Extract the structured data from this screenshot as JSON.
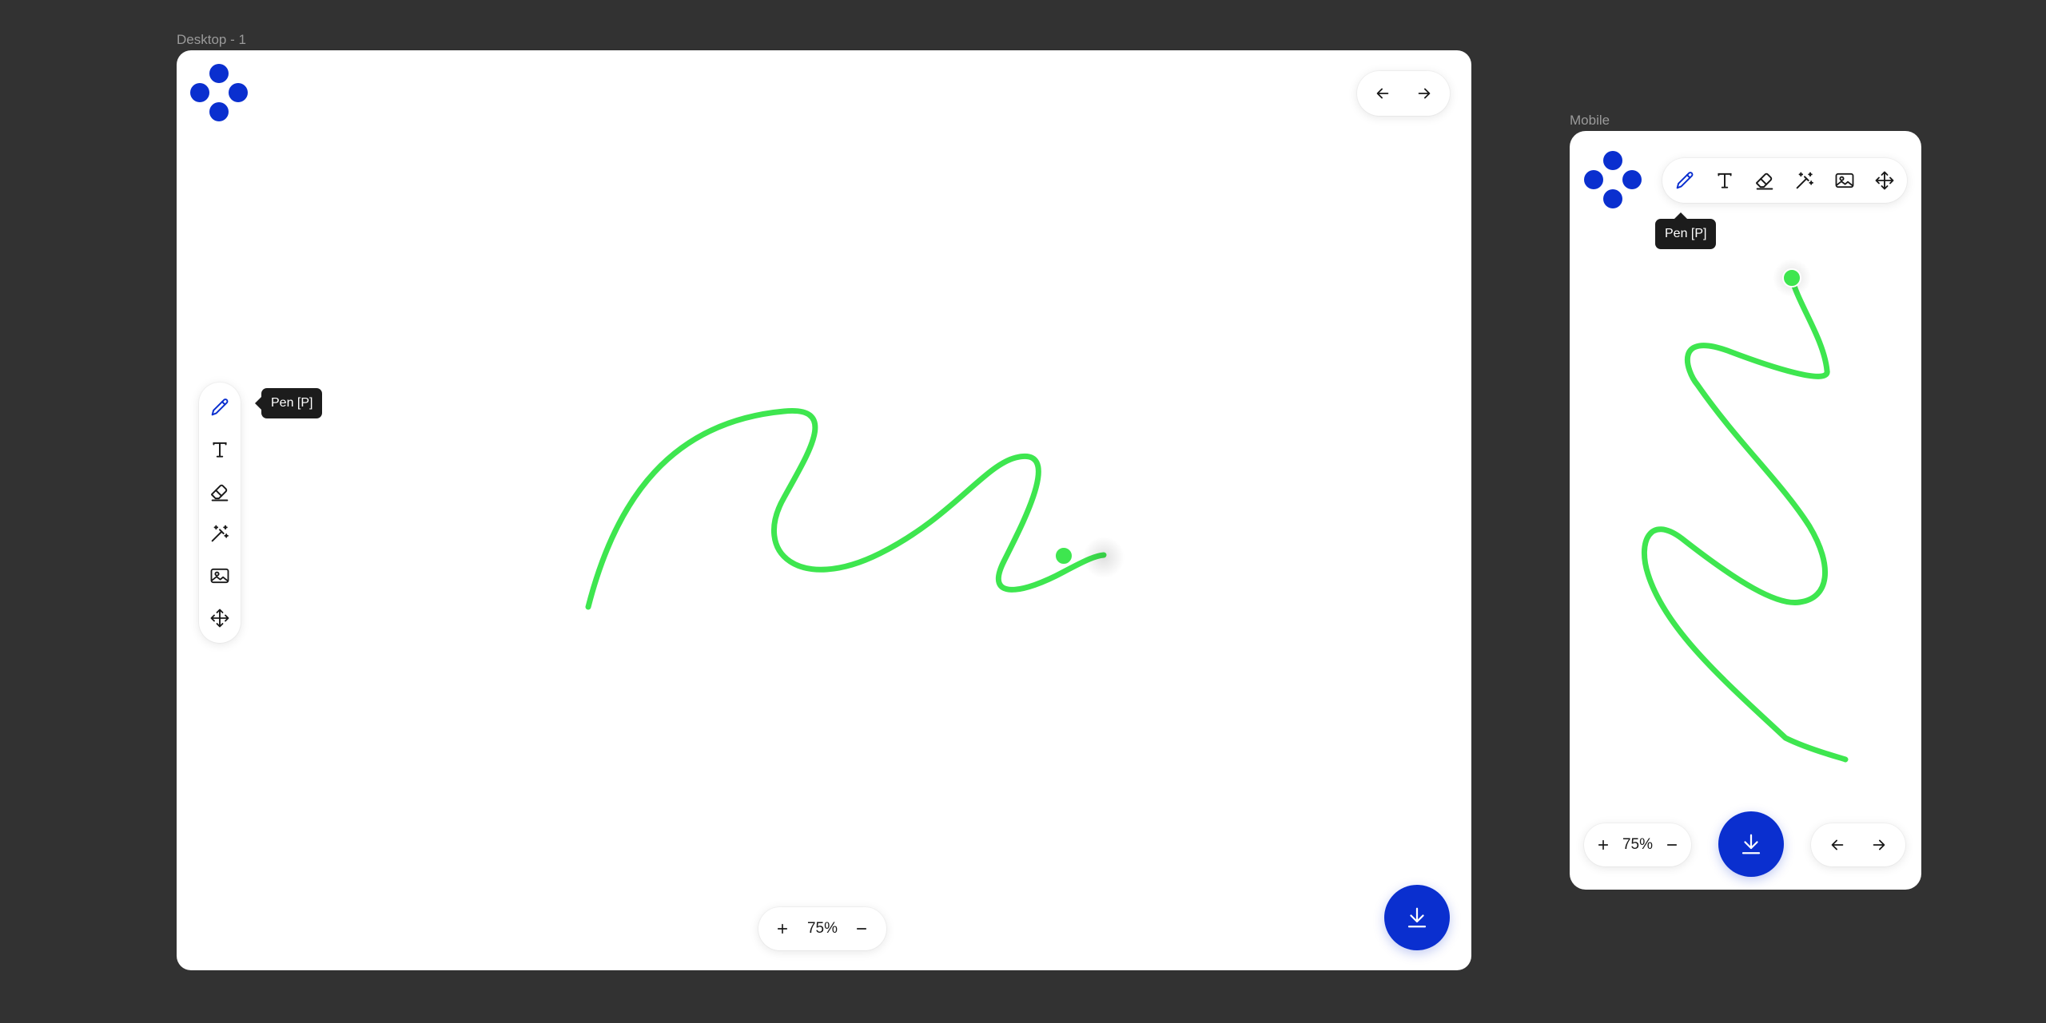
{
  "colors": {
    "background": "#323232",
    "accent": "#0a2fcf",
    "stroke": "#3ee64f",
    "artboard": "#ffffff"
  },
  "desktop": {
    "label": "Desktop - 1",
    "logo_icon": "logo-icon",
    "nav": {
      "back_icon": "arrow-left-icon",
      "forward_icon": "arrow-right-icon"
    },
    "tools": [
      {
        "name": "pen",
        "icon": "pen-icon",
        "active": true
      },
      {
        "name": "text",
        "icon": "text-icon",
        "active": false
      },
      {
        "name": "eraser",
        "icon": "eraser-icon",
        "active": false
      },
      {
        "name": "magic",
        "icon": "magic-wand-icon",
        "active": false
      },
      {
        "name": "image",
        "icon": "image-icon",
        "active": false
      },
      {
        "name": "move",
        "icon": "move-icon",
        "active": false
      }
    ],
    "tooltip": "Pen [P]",
    "zoom": {
      "in_icon": "plus-icon",
      "value": "75%",
      "out_icon": "minus-icon"
    },
    "download_icon": "download-icon"
  },
  "mobile": {
    "label": "Mobile",
    "logo_icon": "logo-icon",
    "tools": [
      {
        "name": "pen",
        "icon": "pen-icon",
        "active": true
      },
      {
        "name": "text",
        "icon": "text-icon",
        "active": false
      },
      {
        "name": "eraser",
        "icon": "eraser-icon",
        "active": false
      },
      {
        "name": "magic",
        "icon": "magic-wand-icon",
        "active": false
      },
      {
        "name": "image",
        "icon": "image-icon",
        "active": false
      },
      {
        "name": "move",
        "icon": "move-icon",
        "active": false
      }
    ],
    "tooltip": "Pen [P]",
    "zoom": {
      "in_icon": "plus-icon",
      "value": "75%",
      "out_icon": "minus-icon"
    },
    "download_icon": "download-icon",
    "nav": {
      "back_icon": "arrow-left-icon",
      "forward_icon": "arrow-right-icon"
    }
  }
}
